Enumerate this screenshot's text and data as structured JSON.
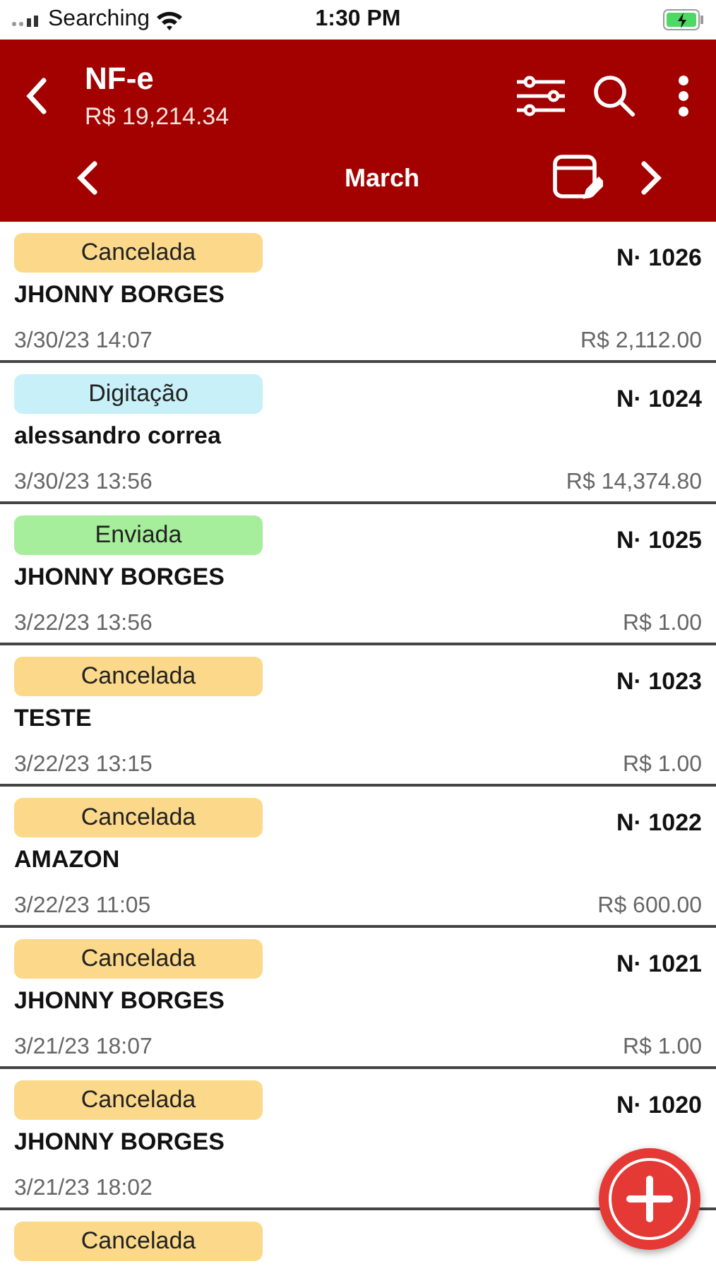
{
  "status_bar": {
    "carrier": "Searching",
    "time": "1:30 PM"
  },
  "header": {
    "title": "NF-e",
    "total": "R$ 19,214.34",
    "period": "March"
  },
  "invoices": [
    {
      "status": "Cancelada",
      "color": "#fcd98a",
      "number": "N· 1026",
      "customer": "JHONNY BORGES",
      "date": "3/30/23 14:07",
      "amount": "R$ 2,112.00"
    },
    {
      "status": "Digitação",
      "color": "#c8f0f8",
      "number": "N· 1024",
      "customer": "alessandro correa",
      "date": "3/30/23 13:56",
      "amount": "R$ 14,374.80"
    },
    {
      "status": "Enviada",
      "color": "#a6ee9c",
      "number": "N· 1025",
      "customer": "JHONNY BORGES",
      "date": "3/22/23 13:56",
      "amount": "R$ 1.00"
    },
    {
      "status": "Cancelada",
      "color": "#fcd98a",
      "number": "N· 1023",
      "customer": "TESTE",
      "date": "3/22/23 13:15",
      "amount": "R$ 1.00"
    },
    {
      "status": "Cancelada",
      "color": "#fcd98a",
      "number": "N· 1022",
      "customer": "AMAZON",
      "date": "3/22/23 11:05",
      "amount": "R$ 600.00"
    },
    {
      "status": "Cancelada",
      "color": "#fcd98a",
      "number": "N· 1021",
      "customer": "JHONNY BORGES",
      "date": "3/21/23 18:07",
      "amount": "R$ 1.00"
    },
    {
      "status": "Cancelada",
      "color": "#fcd98a",
      "number": "N· 1020",
      "customer": "JHONNY BORGES",
      "date": "3/21/23 18:02"
    },
    {
      "status": "Cancelada",
      "color": "#fcd98a"
    }
  ]
}
